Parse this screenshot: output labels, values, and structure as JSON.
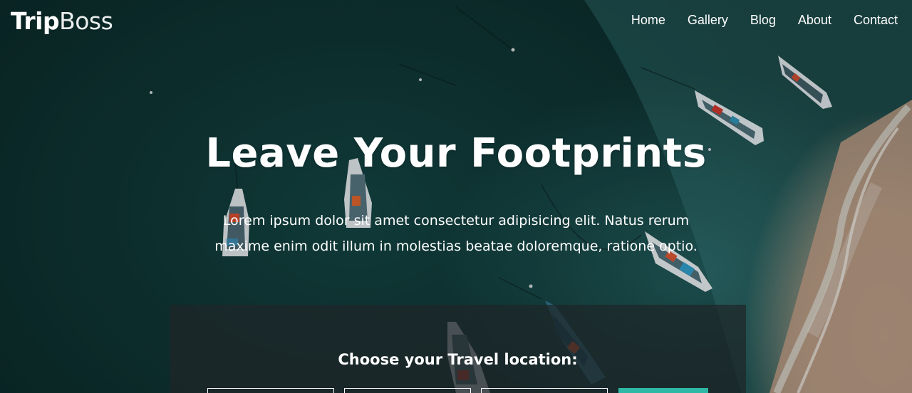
{
  "brand": {
    "strong": "Trip",
    "light": "Boss"
  },
  "nav": {
    "items": [
      {
        "label": "Home"
      },
      {
        "label": "Gallery"
      },
      {
        "label": "Blog"
      },
      {
        "label": "About"
      },
      {
        "label": "Contact"
      }
    ]
  },
  "hero": {
    "title": "Leave Your Footprints",
    "lead": "Lorem ipsum dolor sit amet consectetur adipisicing elit. Natus rerum maxime enim odit illum in molestias beatae doloremque, ratione optio."
  },
  "search": {
    "title": "Choose your Travel location:"
  },
  "colors": {
    "accent": "#2fb8a6",
    "water": "#134241",
    "sand": "#c9a48a"
  }
}
